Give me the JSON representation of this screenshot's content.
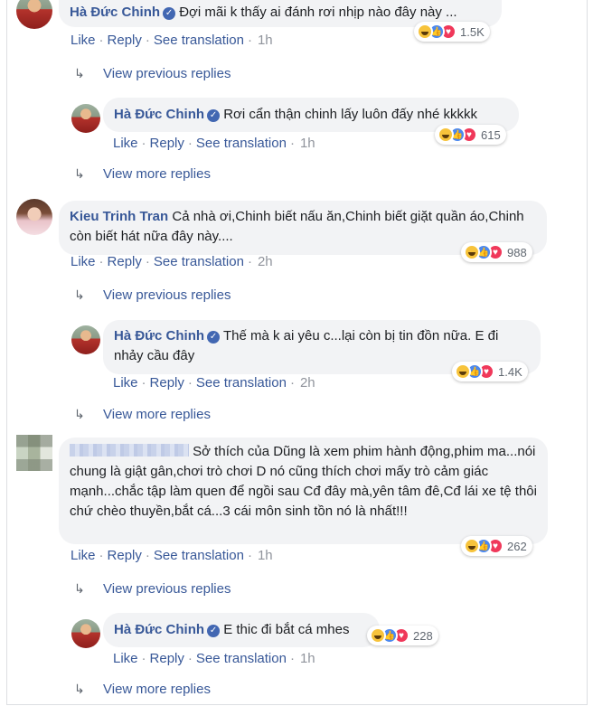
{
  "comments": [
    {
      "author": "Hà Đức Chinh",
      "text": "Đợi mãi k thấy ai đánh rơi nhịp nào đây này ...",
      "like": "Like",
      "reply": "Reply",
      "translate": "See translation",
      "time": "1h",
      "reactions": "1.5K",
      "view_previous": "View previous replies",
      "reply_item": {
        "author": "Hà Đức Chinh",
        "text": "Rơi cẩn thận chinh lấy luôn đấy nhé kkkkk",
        "like": "Like",
        "reply": "Reply",
        "translate": "See translation",
        "time": "1h",
        "reactions": "615"
      },
      "view_more": "View more replies"
    },
    {
      "author": "Kieu Trinh Tran",
      "text": "Cả nhà ơi,Chinh biết nấu ăn,Chinh biết giặt quần áo,Chinh còn biết hát nữa đây này....",
      "like": "Like",
      "reply": "Reply",
      "translate": "See translation",
      "time": "2h",
      "reactions": "988",
      "view_previous": "View previous replies",
      "reply_item": {
        "author": "Hà Đức Chinh",
        "text": "Thế mà k ai yêu c...lại còn bị tin đồn nữa. E đi nhảy cầu đây",
        "like": "Like",
        "reply": "Reply",
        "translate": "See translation",
        "time": "2h",
        "reactions": "1.4K"
      },
      "view_more": "View more replies"
    },
    {
      "author": "",
      "text": "Sở thích của Dũng là xem phim hành động,phim ma...nói chung là giật gân,chơi trò chơi D nó cũng thích chơi mấy trò cảm giác mạnh...chắc tập làm quen để ngồi sau Cđ đây mà,yên tâm đê,Cđ lái xe tệ thôi chứ chèo thuyền,bắt cá...3 cái môn sinh tồn nó là nhất!!!",
      "like": "Like",
      "reply": "Reply",
      "translate": "See translation",
      "time": "1h",
      "reactions": "262",
      "view_previous": "View previous replies",
      "reply_item": {
        "author": "Hà Đức Chinh",
        "text": "E thic đi bắt cá mhes",
        "like": "Like",
        "reply": "Reply",
        "translate": "See translation",
        "time": "1h",
        "reactions": "228"
      },
      "view_more": "View more replies"
    }
  ],
  "icons": {
    "verified": "verified-badge-icon",
    "reply_arrow": "reply-arrow-icon",
    "haha": "haha-reaction-icon",
    "like": "like-reaction-icon",
    "love": "love-reaction-icon"
  },
  "colors": {
    "link": "#385898",
    "bubble": "#f2f3f5",
    "meta": "#90949c"
  }
}
